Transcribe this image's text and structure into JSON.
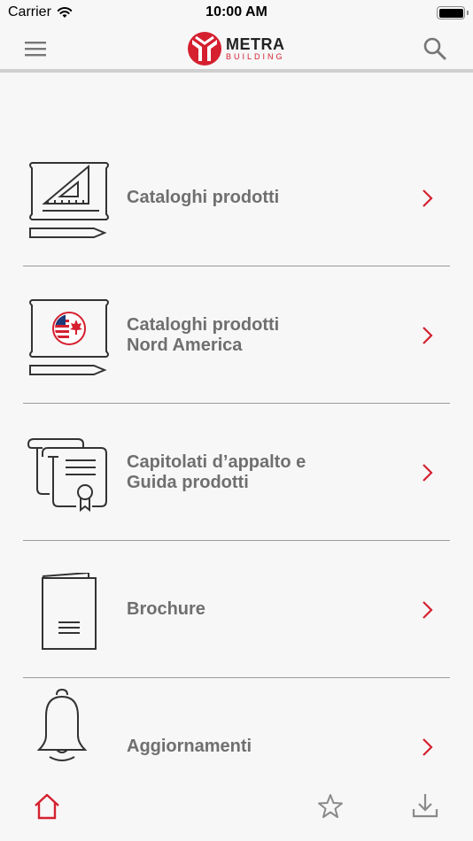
{
  "status_bar": {
    "carrier": "Carrier",
    "time": "10:00 AM",
    "battery_level": 1.0
  },
  "header": {
    "logo": {
      "brand": "METRA",
      "sub": "BUILDING"
    },
    "menu_icon": "hamburger-menu-icon",
    "search_icon": "search-icon"
  },
  "menu": {
    "items": [
      {
        "label": "Cataloghi prodotti",
        "icon": "blueprint-triangle-icon"
      },
      {
        "label": "Cataloghi prodotti\nNord America",
        "icon": "blueprint-flag-icon"
      },
      {
        "label": "Capitolati d’appalto e\nGuida prodotti",
        "icon": "certificate-document-icon"
      },
      {
        "label": "Brochure",
        "icon": "brochure-icon"
      },
      {
        "label": "Aggiornamenti",
        "icon": "bell-icon"
      }
    ]
  },
  "tab_bar": {
    "items": [
      {
        "name": "home",
        "icon": "home-icon",
        "active": true
      },
      {
        "name": "favorites",
        "icon": "star-icon",
        "active": false
      },
      {
        "name": "downloads",
        "icon": "download-icon",
        "active": false
      }
    ]
  },
  "colors": {
    "accent": "#d5202f",
    "text": "#6f6f6f",
    "background": "#f7f7f7",
    "divider": "#9a9a9a",
    "icon": "#8a8a8a"
  }
}
